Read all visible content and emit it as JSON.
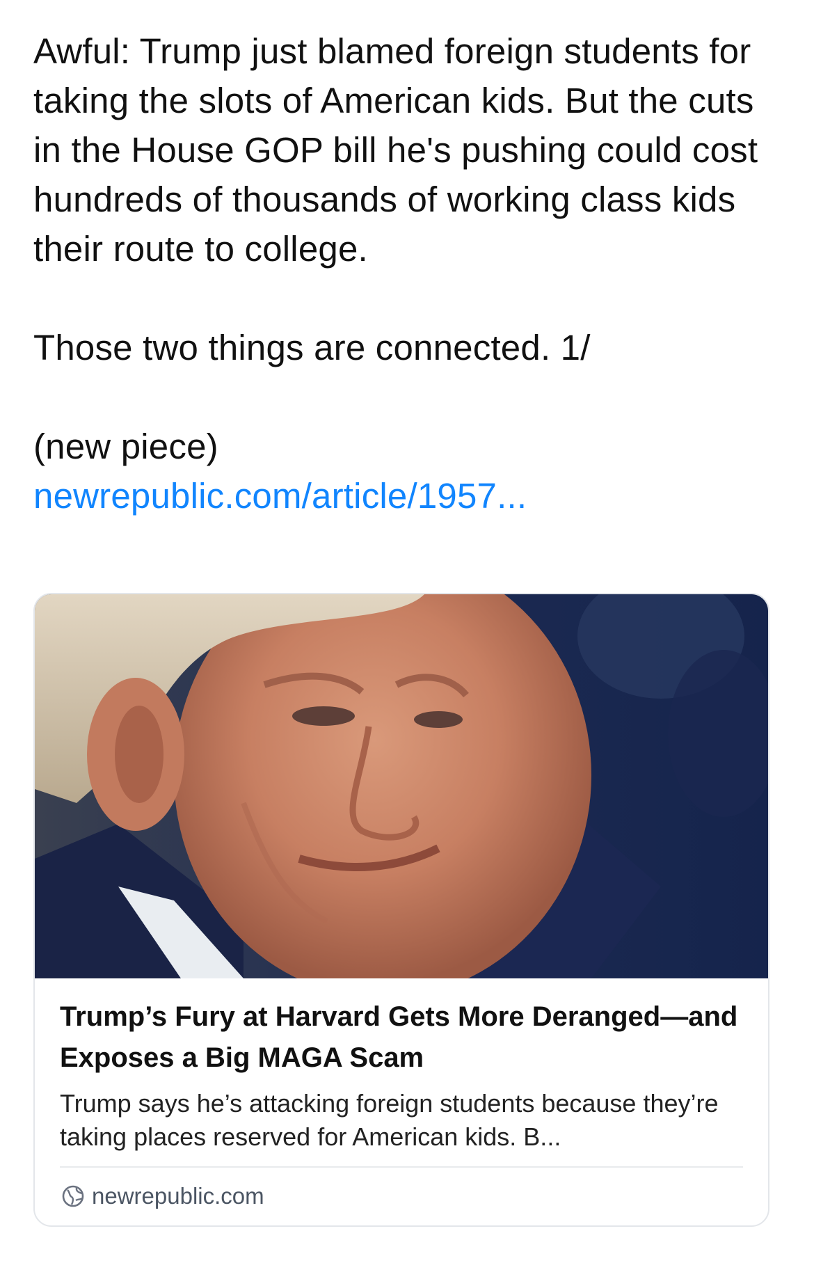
{
  "post": {
    "paragraphs": [
      "Awful: Trump just blamed foreign students for taking the slots of American kids. But the cuts in the House GOP bill he's pushing could cost hundreds of thousands of working class kids their route to college.",
      "Those two things are connected. 1/",
      "(new piece)"
    ],
    "link_text": "newrepublic.com/article/1957..."
  },
  "link_card": {
    "image_icon": "news-photo",
    "title": "Trump’s Fury at Harvard Gets More Deranged—and Exposes a Big MAGA Scam",
    "description": "Trump says he’s attacking foreign students because they’re taking places reserved for American kids. B...",
    "domain": "newrepublic.com",
    "domain_icon": "globe-icon"
  },
  "colors": {
    "link": "#1185fe",
    "text": "#111111",
    "card_border": "#e3e6ea",
    "photo_background": "#15244c"
  }
}
